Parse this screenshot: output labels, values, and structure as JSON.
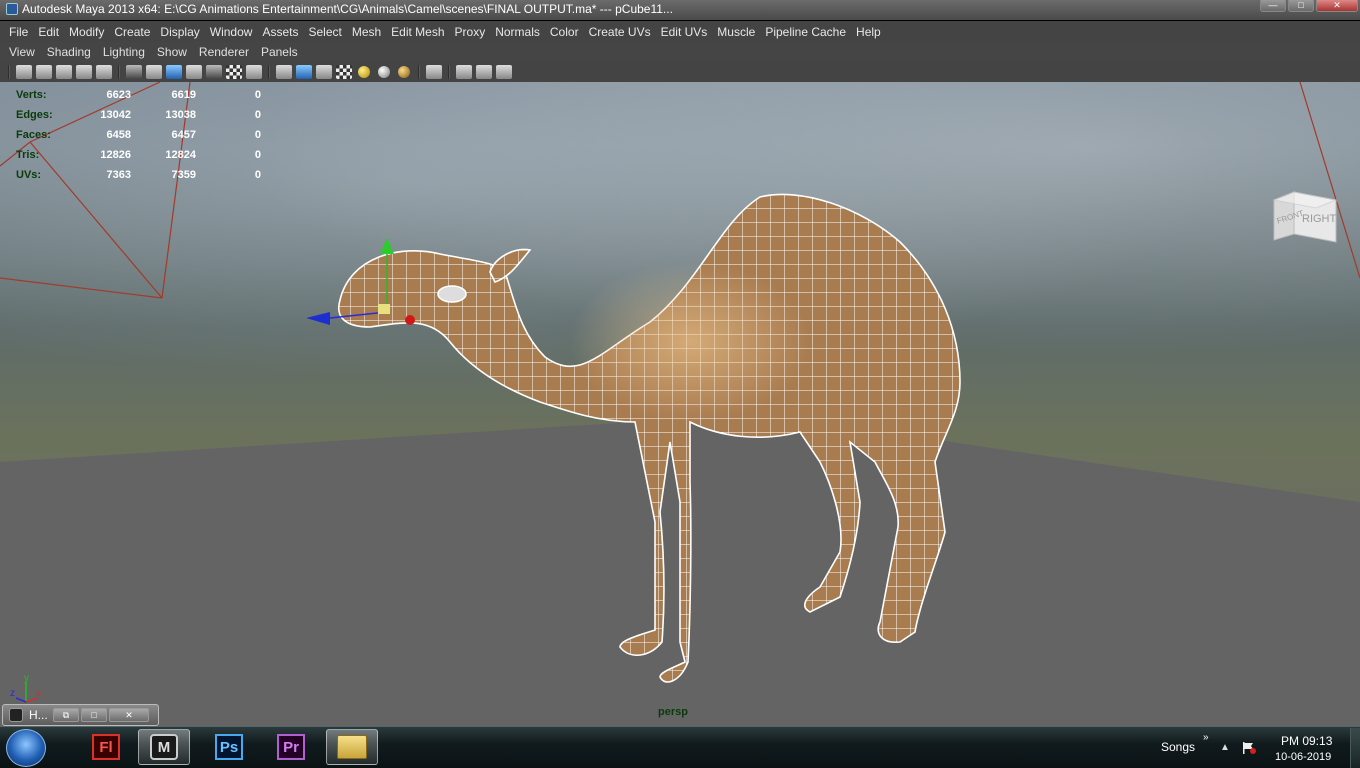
{
  "window": {
    "title": "Autodesk Maya 2013 x64: E:\\CG Animations Entertainment\\CG\\Animals\\Camel\\scenes\\FINAL OUTPUT.ma*   ---   pCube11...",
    "buttons": {
      "minimize": "—",
      "maximize": "□",
      "close": "✕"
    }
  },
  "menubar": [
    "File",
    "Edit",
    "Modify",
    "Create",
    "Display",
    "Window",
    "Assets",
    "Select",
    "Mesh",
    "Edit Mesh",
    "Proxy",
    "Normals",
    "Color",
    "Create UVs",
    "Edit UVs",
    "Muscle",
    "Pipeline Cache",
    "Help"
  ],
  "panel_menu": [
    "View",
    "Shading",
    "Lighting",
    "Show",
    "Renderer",
    "Panels"
  ],
  "toolbar_icons": [
    "camera-select-icon",
    "camera-attributes-icon",
    "bookmark-icon",
    "image-plane-icon",
    "grid-icon",
    "wireframe-icon",
    "resolution-gate-icon",
    "field-chart-icon",
    "safe-action-icon",
    "film-gate-icon",
    "2d-pan-icon",
    "text-overlay-icon",
    "wireframe-shade-icon",
    "smooth-shade-icon",
    "flat-shade-icon",
    "textured-icon",
    "default-light-icon",
    "all-lights-icon",
    "shadows-icon",
    "isolate-select-icon",
    "xray-icon",
    "backface-icon",
    "joints-icon"
  ],
  "hud": {
    "rows": [
      {
        "label": "Verts:",
        "a": "6623",
        "b": "6619",
        "c": "0"
      },
      {
        "label": "Edges:",
        "a": "13042",
        "b": "13038",
        "c": "0"
      },
      {
        "label": "Faces:",
        "a": "6458",
        "b": "6457",
        "c": "0"
      },
      {
        "label": "Tris:",
        "a": "12826",
        "b": "12824",
        "c": "0"
      },
      {
        "label": "UVs:",
        "a": "7363",
        "b": "7359",
        "c": "0"
      }
    ]
  },
  "viewcube": {
    "front": "FRONT",
    "right": "RIGHT"
  },
  "axis": {
    "y": "y",
    "x": "x",
    "z": "z"
  },
  "camera_name": "persp",
  "minimized_window": {
    "title": "H...",
    "buttons": [
      "⧉",
      "□",
      "✕"
    ]
  },
  "taskbar": {
    "apps": [
      {
        "name": "Flash",
        "glyph": "Fl"
      },
      {
        "name": "Maya",
        "glyph": "M"
      },
      {
        "name": "Photoshop",
        "glyph": "Ps"
      },
      {
        "name": "Premiere",
        "glyph": "Pr"
      },
      {
        "name": "Explorer",
        "glyph": ""
      }
    ],
    "tray_label": "Songs",
    "tray_chevron": "»",
    "tray_arrow": "▲",
    "time": "PM 09:13",
    "date": "10-06-2019"
  },
  "colors": {
    "hud_label": "#0b3a0b",
    "camel_fill": "#b08557",
    "wire": "#ffffff"
  }
}
